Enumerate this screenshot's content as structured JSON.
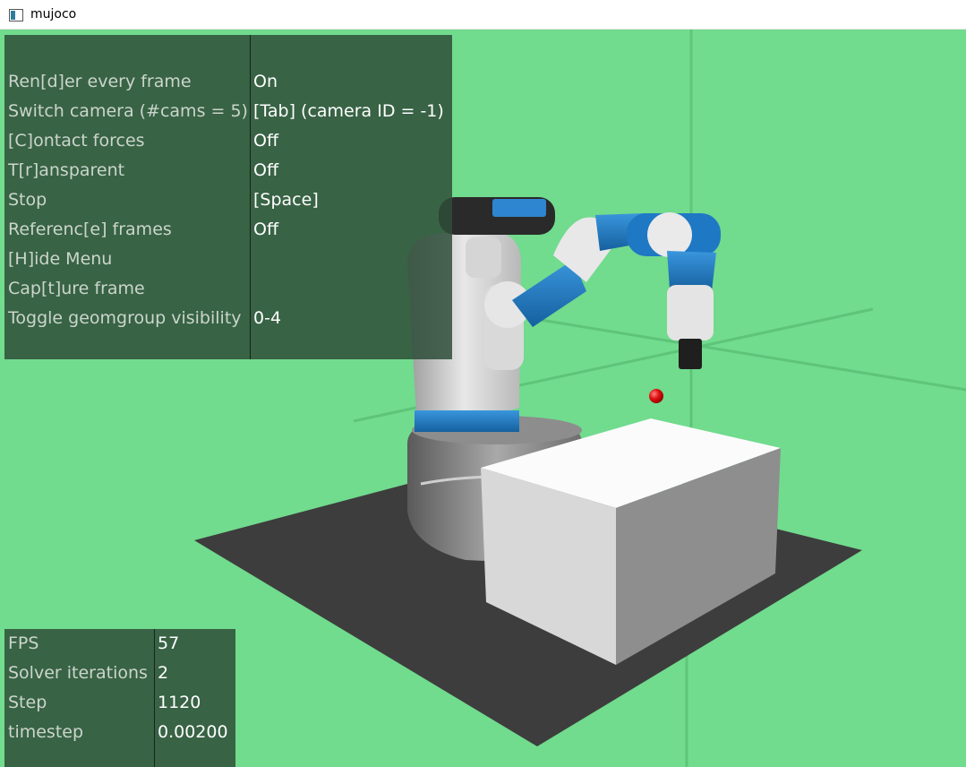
{
  "window": {
    "title": "mujoco",
    "icon": "window-icon"
  },
  "menu": {
    "rows": [
      {
        "label": "Ren[d]er every frame",
        "value": "On"
      },
      {
        "label": "Switch camera (#cams = 5)",
        "value": "[Tab] (camera ID = -1)"
      },
      {
        "label": "[C]ontact forces",
        "value": "Off"
      },
      {
        "label": "T[r]ansparent",
        "value": "Off"
      },
      {
        "label": "Stop",
        "value": "[Space]"
      },
      {
        "label": "Referenc[e] frames",
        "value": "Off"
      },
      {
        "label": "[H]ide Menu",
        "value": ""
      },
      {
        "label": "Cap[t]ure frame",
        "value": ""
      },
      {
        "label": "Toggle geomgroup visibility",
        "value": "0-4"
      }
    ]
  },
  "stats": {
    "rows": [
      {
        "label": "FPS",
        "value": "57"
      },
      {
        "label": "Solver iterations",
        "value": "2"
      },
      {
        "label": "Step",
        "value": "1120"
      },
      {
        "label": "timestep",
        "value": "0.00200"
      }
    ]
  },
  "colors": {
    "background": "#71db8e",
    "panel": "#2e4d38",
    "arm_blue": "#1f78c4",
    "target": "#e01010"
  }
}
